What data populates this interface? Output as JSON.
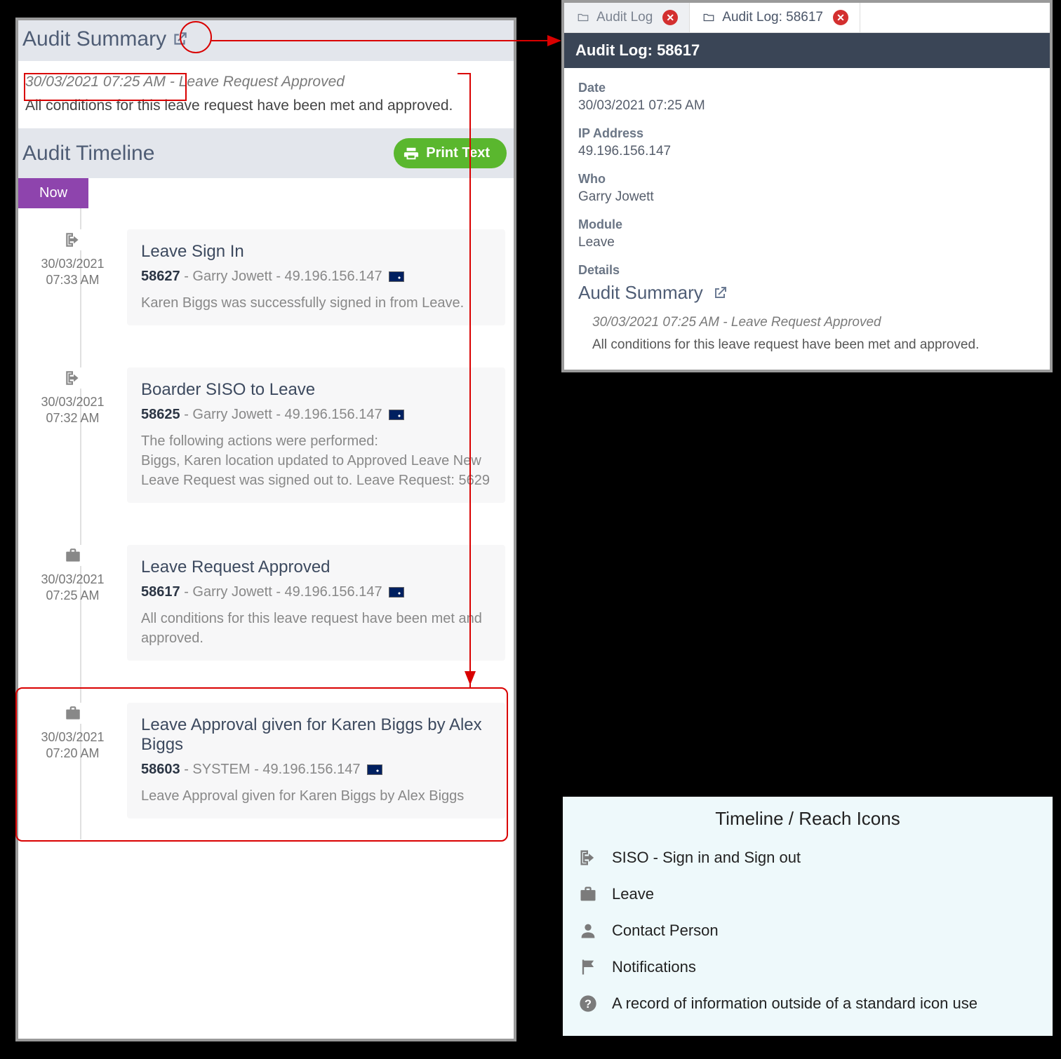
{
  "summary": {
    "title": "Audit Summary",
    "line1": "30/03/2021 07:25 AM - Leave Request Approved",
    "line2": "All conditions for this leave request have been met and approved."
  },
  "timeline": {
    "title": "Audit Timeline",
    "print_label": "Print Text",
    "now_label": "Now",
    "items": [
      {
        "icon": "siso",
        "date": "30/03/2021",
        "time": "07:33 AM",
        "title": "Leave Sign In",
        "id": "58627",
        "who": "Garry Jowett",
        "ip": "49.196.156.147",
        "desc": "Karen Biggs was successfully signed in from Leave."
      },
      {
        "icon": "siso",
        "date": "30/03/2021",
        "time": "07:32 AM",
        "title": "Boarder SISO to Leave",
        "id": "58625",
        "who": "Garry Jowett",
        "ip": "49.196.156.147",
        "desc": "The following actions were performed:\nBiggs, Karen location updated to Approved Leave New Leave Request was signed out to. Leave Request: 5629"
      },
      {
        "icon": "briefcase",
        "date": "30/03/2021",
        "time": "07:25 AM",
        "title": "Leave Request Approved",
        "id": "58617",
        "who": "Garry Jowett",
        "ip": "49.196.156.147",
        "desc": "All conditions for this leave request have been met and approved."
      },
      {
        "icon": "briefcase",
        "date": "30/03/2021",
        "time": "07:20 AM",
        "title": "Leave Approval given for Karen Biggs by Alex Biggs",
        "id": "58603",
        "who": "SYSTEM",
        "ip": "49.196.156.147",
        "desc": "Leave Approval given for Karen Biggs by Alex Biggs"
      }
    ]
  },
  "tabs": {
    "tab1": "Audit Log",
    "tab2": "Audit Log: 58617"
  },
  "log": {
    "header": "Audit Log: 58617",
    "date_label": "Date",
    "date_value": "30/03/2021 07:25 AM",
    "ip_label": "IP Address",
    "ip_value": "49.196.156.147",
    "who_label": "Who",
    "who_value": "Garry Jowett",
    "module_label": "Module",
    "module_value": "Leave",
    "details_label": "Details",
    "summary_title": "Audit Summary",
    "summary_line1": "30/03/2021 07:25 AM - Leave Request Approved",
    "summary_line2": "All conditions for this leave request have been met and approved."
  },
  "legend": {
    "title": "Timeline / Reach Icons",
    "rows": [
      {
        "icon": "siso",
        "label": "SISO - Sign in and Sign out"
      },
      {
        "icon": "briefcase",
        "label": "Leave"
      },
      {
        "icon": "person",
        "label": "Contact Person"
      },
      {
        "icon": "flag",
        "label": "Notifications"
      },
      {
        "icon": "question",
        "label": "A record of information outside of a standard icon use"
      }
    ]
  }
}
